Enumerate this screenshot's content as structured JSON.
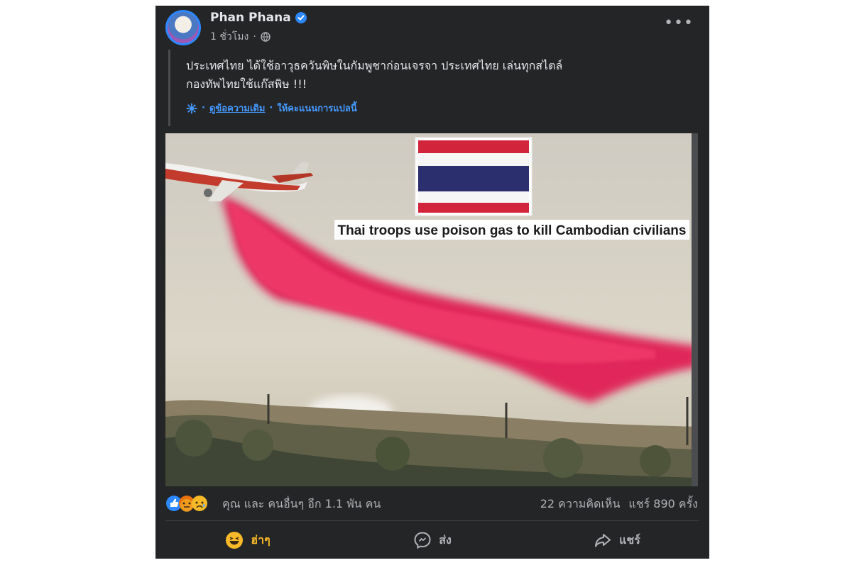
{
  "post": {
    "author": "Phan Phana",
    "time": "1 ชั่วโมง",
    "separator": "·",
    "more_label": "•••",
    "body_line1": "ประเทศไทย ได้ใช้อาวุธควันพิษในกัมพูชาก่อนเจรจา ประเทศไทย เล่นทุกสไตล์",
    "body_line2": "กองทัพไทยใช้แก๊สพิษ !!!",
    "see_original": "ดูข้อความเดิม",
    "translate_sep": "·",
    "rate_translation": "ให้คะแนนการแปลนี้"
  },
  "image": {
    "caption": "Thai troops use poison gas to kill Cambodian civilians"
  },
  "stats": {
    "reactions_text": "คุณ และ คนอื่นๆ อีก 1.1 พัน คน",
    "comments": "22 ความคิดเห็น",
    "shares": "แชร์ 890 ครั้ง"
  },
  "actions": {
    "haha": "ฮ่าๆ",
    "send": "ส่ง",
    "share": "แชร์"
  },
  "colors": {
    "card_bg": "#242526",
    "link_blue": "#4599ff",
    "haha_yellow": "#f7b928",
    "retardant_pink": "#e0285a"
  },
  "icons": [
    "verified-badge-icon",
    "globe-icon",
    "more-options-icon",
    "translate-gear-icon",
    "like-icon",
    "angry-icon",
    "sad-icon",
    "haha-icon",
    "messenger-icon",
    "share-arrow-icon"
  ]
}
